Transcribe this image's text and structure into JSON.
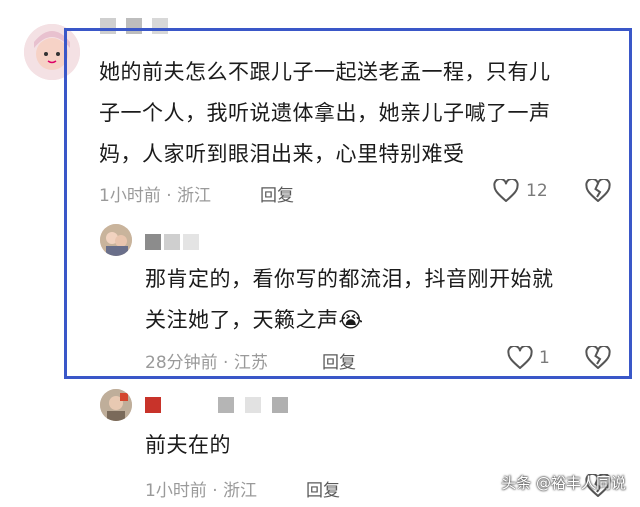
{
  "comments": [
    {
      "text_lines": [
        "她的前夫怎么不跟儿子一起送老孟一程，只有儿",
        "子一个人，我听说遗体拿出，她亲儿子喊了一声",
        "妈，人家听到眼泪出来，心里特别难受"
      ],
      "meta": "1小时前 · 浙江",
      "reply_label": "回复",
      "like_count": "12"
    },
    {
      "text_lines": [
        "那肯定的，看你写的都流泪，抖音刚开始就",
        "关注她了，天籁之声"
      ],
      "emoji": "😭",
      "meta": "28分钟前 · 江苏",
      "reply_label": "回复",
      "like_count": "1"
    },
    {
      "text_lines": [
        "前夫在的"
      ],
      "meta": "1小时前 · 浙江",
      "reply_label": "回复"
    }
  ],
  "watermark": "头条 @裕丰人同说",
  "colors": {
    "highlight_border": "#3a57c8",
    "meta_text": "#9a9a9a",
    "icon": "#555555"
  }
}
